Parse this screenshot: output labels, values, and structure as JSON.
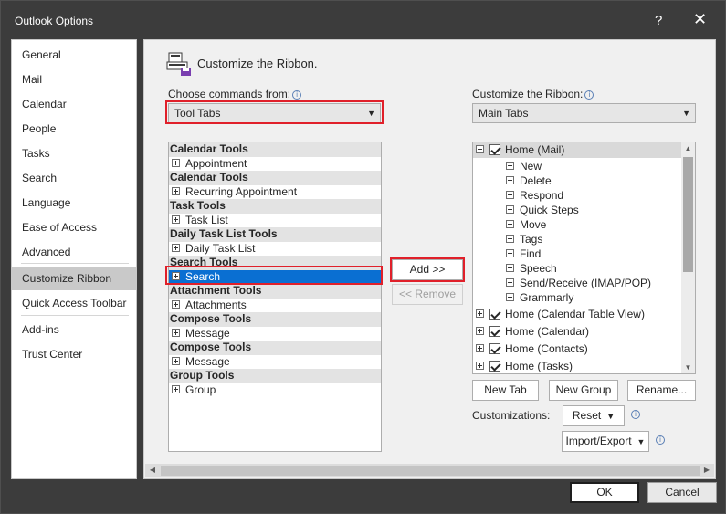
{
  "window": {
    "title": "Outlook Options",
    "help": "?",
    "close": "✕"
  },
  "nav": {
    "items": [
      {
        "label": "General"
      },
      {
        "label": "Mail"
      },
      {
        "label": "Calendar"
      },
      {
        "label": "People"
      },
      {
        "label": "Tasks"
      },
      {
        "label": "Search"
      },
      {
        "label": "Language"
      },
      {
        "label": "Ease of Access"
      },
      {
        "label": "Advanced"
      },
      {
        "label": "Customize Ribbon"
      },
      {
        "label": "Quick Access Toolbar"
      },
      {
        "label": "Add-ins"
      },
      {
        "label": "Trust Center"
      }
    ],
    "selected": "Customize Ribbon"
  },
  "main": {
    "heading": "Customize the Ribbon.",
    "choose_label": "Choose commands from:",
    "choose_value": "Tool Tabs",
    "customize_label": "Customize the Ribbon:",
    "customize_value": "Main Tabs",
    "info_glyph": "i",
    "left_list": [
      {
        "type": "group",
        "label": "Calendar Tools"
      },
      {
        "type": "item",
        "label": "Appointment"
      },
      {
        "type": "group",
        "label": "Calendar Tools"
      },
      {
        "type": "item",
        "label": "Recurring Appointment"
      },
      {
        "type": "group",
        "label": "Task Tools"
      },
      {
        "type": "item",
        "label": "Task List"
      },
      {
        "type": "group",
        "label": "Daily Task List Tools"
      },
      {
        "type": "item",
        "label": "Daily Task List"
      },
      {
        "type": "group",
        "label": "Search Tools"
      },
      {
        "type": "item",
        "label": "Search",
        "selected": true
      },
      {
        "type": "group",
        "label": "Attachment Tools"
      },
      {
        "type": "item",
        "label": "Attachments"
      },
      {
        "type": "group",
        "label": "Compose Tools"
      },
      {
        "type": "item",
        "label": "Message"
      },
      {
        "type": "group",
        "label": "Compose Tools"
      },
      {
        "type": "item",
        "label": "Message"
      },
      {
        "type": "group",
        "label": "Group Tools"
      },
      {
        "type": "item",
        "label": "Group"
      }
    ],
    "add_button": "Add >>",
    "remove_button": "<< Remove",
    "right_tree": [
      {
        "level": 0,
        "expanded": true,
        "checked": true,
        "label": "Home (Mail)",
        "highlight": true
      },
      {
        "level": 1,
        "label": "New"
      },
      {
        "level": 1,
        "label": "Delete"
      },
      {
        "level": 1,
        "label": "Respond"
      },
      {
        "level": 1,
        "label": "Quick Steps"
      },
      {
        "level": 1,
        "label": "Move"
      },
      {
        "level": 1,
        "label": "Tags"
      },
      {
        "level": 1,
        "label": "Find"
      },
      {
        "level": 1,
        "label": "Speech"
      },
      {
        "level": 1,
        "label": "Send/Receive (IMAP/POP)"
      },
      {
        "level": 1,
        "label": "Grammarly"
      },
      {
        "level": 0,
        "expanded": false,
        "checked": true,
        "label": "Home (Calendar Table View)"
      },
      {
        "level": 0,
        "expanded": false,
        "checked": true,
        "label": "Home (Calendar)"
      },
      {
        "level": 0,
        "expanded": false,
        "checked": true,
        "label": "Home (Contacts)"
      },
      {
        "level": 0,
        "expanded": false,
        "checked": true,
        "label": "Home (Tasks)"
      }
    ],
    "new_tab": "New Tab",
    "new_group": "New Group",
    "rename": "Rename...",
    "customizations_label": "Customizations:",
    "reset": "Reset",
    "import_export": "Import/Export"
  },
  "footer": {
    "ok": "OK",
    "cancel": "Cancel"
  },
  "colors": {
    "accent": "#0a6fd2",
    "highlight_box": "#e0202a",
    "titlebar": "#3c3c3c"
  }
}
